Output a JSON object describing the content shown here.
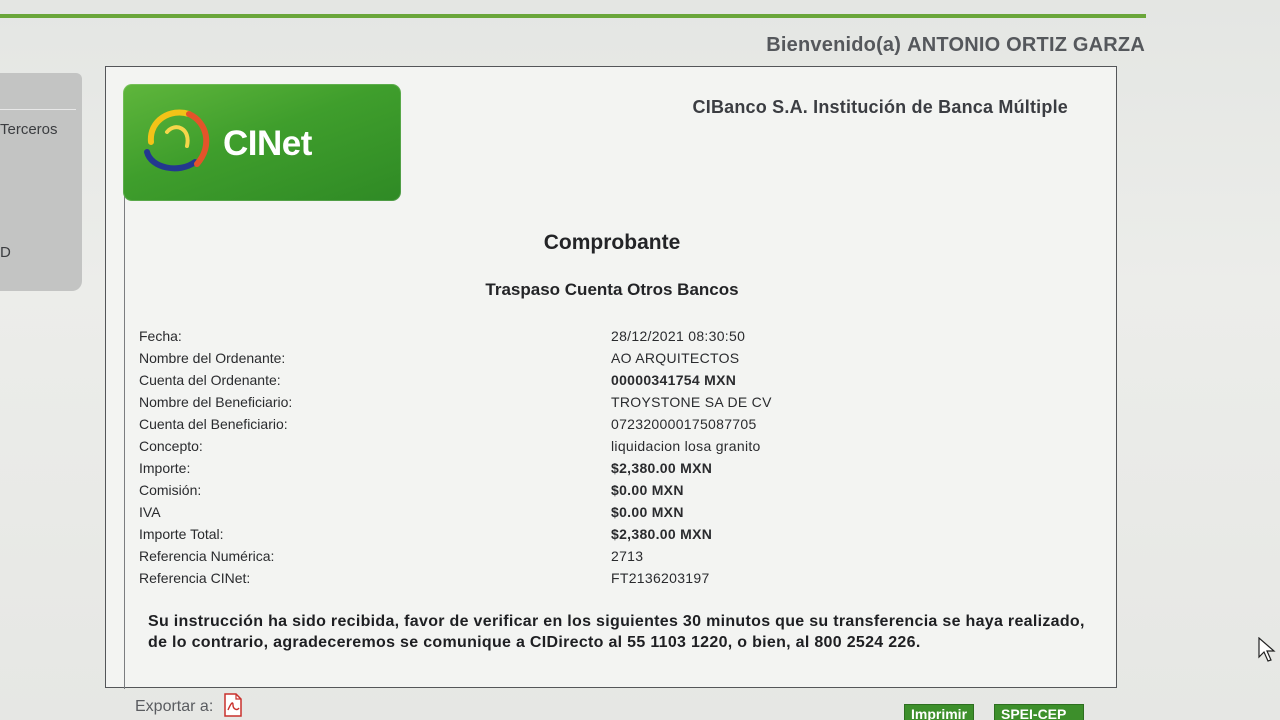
{
  "header": {
    "welcome_label": "Bienvenido(a)",
    "user_name": "ANTONIO ORTIZ GARZA"
  },
  "sidebar": {
    "items": [
      {
        "label": "Terceros"
      },
      {
        "label": "D"
      }
    ]
  },
  "receipt": {
    "logo_text": "CINet",
    "bank_name": "CIBanco S.A. Institución de Banca Múltiple",
    "title": "Comprobante",
    "subtitle": "Traspaso Cuenta Otros Bancos",
    "rows": [
      {
        "label": "Fecha:",
        "value": "28/12/2021 08:30:50"
      },
      {
        "label": "Nombre del Ordenante:",
        "value": "AO ARQUITECTOS"
      },
      {
        "label": "Cuenta del Ordenante:",
        "value": "00000341754 MXN"
      },
      {
        "label": "Nombre del Beneficiario:",
        "value": "TROYSTONE SA DE CV"
      },
      {
        "label": "Cuenta del Beneficiario:",
        "value": "072320000175087705"
      },
      {
        "label": "Concepto:",
        "value": "liquidacion losa granito"
      },
      {
        "label": "Importe:",
        "value": "$2,380.00 MXN"
      },
      {
        "label": "Comisión:",
        "value": "$0.00 MXN"
      },
      {
        "label": "IVA",
        "value": "$0.00 MXN"
      },
      {
        "label": "Importe Total:",
        "value": "$2,380.00 MXN"
      },
      {
        "label": "Referencia Numérica:",
        "value": "2713"
      },
      {
        "label": "Referencia CINet:",
        "value": "FT2136203197"
      }
    ],
    "notice": "Su instrucción ha sido recibida, favor de verificar en los siguientes 30 minutos que su transferencia se haya realizado, de lo contrario, agradeceremos se comunique a CIDirecto al 55 1103 1220, o bien, al 800 2524 226."
  },
  "footer": {
    "export_label": "Exportar a:",
    "print_label": "Imprimir",
    "spei_label": "SPEI-CEP"
  },
  "colors": {
    "brand_green": "#3f9e2c",
    "rule_green": "#6aa63a"
  }
}
